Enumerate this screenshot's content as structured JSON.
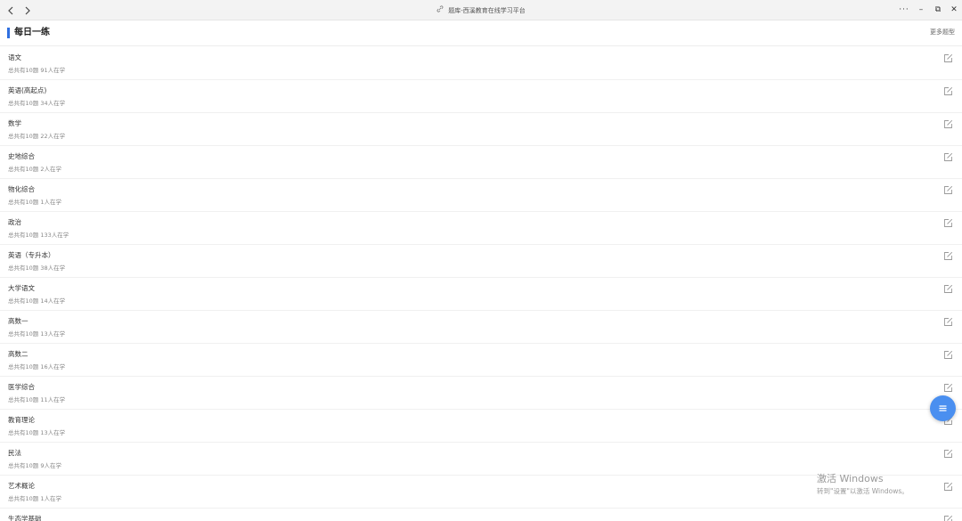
{
  "window": {
    "title": "题库-西溪教育在线学习平台",
    "back_icon": "chevron-left-icon",
    "forward_icon": "chevron-right-icon",
    "more_label": "···",
    "minimize_label": "–",
    "restore_label": "⧉",
    "close_label": "✕"
  },
  "header": {
    "title": "每日一练",
    "more_link": "更多题型",
    "accent_color": "#2f6fe0"
  },
  "subjects": [
    {
      "name": "语文",
      "meta": "总共有10题 91人在学"
    },
    {
      "name": "英语(高起点)",
      "meta": "总共有10题 34人在学"
    },
    {
      "name": "数学",
      "meta": "总共有10题 22人在学"
    },
    {
      "name": "史地综合",
      "meta": "总共有10题 2人在学"
    },
    {
      "name": "物化综合",
      "meta": "总共有10题 1人在学"
    },
    {
      "name": "政治",
      "meta": "总共有10题 133人在学"
    },
    {
      "name": "英语（专升本）",
      "meta": "总共有10题 38人在学"
    },
    {
      "name": "大学语文",
      "meta": "总共有10题 14人在学"
    },
    {
      "name": "高数一",
      "meta": "总共有10题 13人在学"
    },
    {
      "name": "高数二",
      "meta": "总共有10题 16人在学"
    },
    {
      "name": "医学综合",
      "meta": "总共有10题 11人在学"
    },
    {
      "name": "教育理论",
      "meta": "总共有10题 13人在学"
    },
    {
      "name": "民法",
      "meta": "总共有10题 9人在学"
    },
    {
      "name": "艺术概论",
      "meta": "总共有10题 1人在学"
    },
    {
      "name": "生态学基础",
      "meta": ""
    }
  ],
  "fab": {
    "icon": "menu-icon",
    "color": "#4a8ff0"
  },
  "watermark": {
    "title": "激活 Windows",
    "subtitle": "转到\"设置\"以激活 Windows。"
  }
}
